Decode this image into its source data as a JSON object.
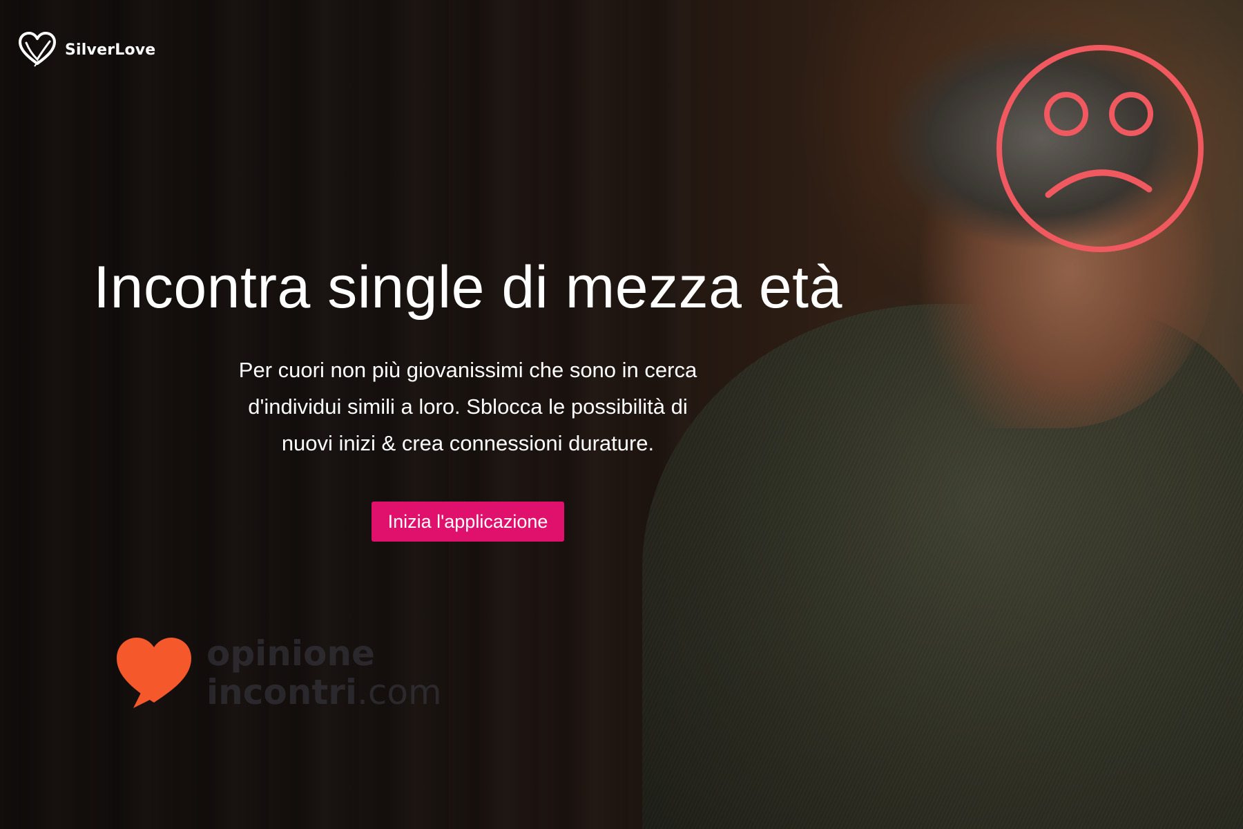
{
  "brand": {
    "name": "SilverLove",
    "logo_icon": "heart-outline-icon"
  },
  "hero": {
    "title": "Incontra single di mezza età",
    "subtitle": "Per cuori non più giovanissimi che sono in cerca d'individui simili a loro. Sblocca le possibilità di nuovi inizi & crea connessioni durature.",
    "cta_label": "Inizia l'applicazione"
  },
  "overlays": {
    "sad_face_icon": "sad-face-icon",
    "sad_face_color": "#f0595f"
  },
  "watermark": {
    "line1": "opinione",
    "line2_main": "incontri",
    "line2_suffix": ".com",
    "heart_color": "#f5582b"
  },
  "colors": {
    "cta_background": "#e0116d",
    "text": "#ffffff"
  }
}
